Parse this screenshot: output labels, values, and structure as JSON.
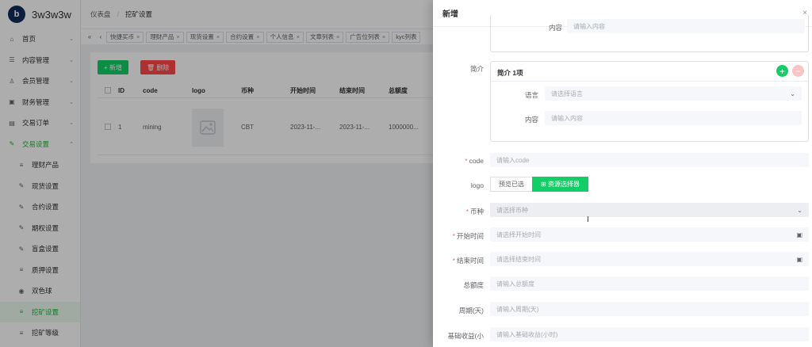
{
  "brand": {
    "name": "3w3w3w",
    "logo_letter": "b"
  },
  "sidebar": {
    "items": [
      {
        "label": "首页",
        "icon": "home-icon",
        "glyph": "⌂"
      },
      {
        "label": "内容管理",
        "icon": "list-icon",
        "glyph": "☰"
      },
      {
        "label": "会员管理",
        "icon": "user-icon",
        "glyph": "♙"
      },
      {
        "label": "财务管理",
        "icon": "finance-icon",
        "glyph": "▣"
      },
      {
        "label": "交易订单",
        "icon": "order-icon",
        "glyph": "▤"
      },
      {
        "label": "交易设置",
        "icon": "tool-icon",
        "glyph": "✎"
      }
    ],
    "sub_items": [
      {
        "label": "理财产品",
        "icon": "menu-lines-icon",
        "glyph": "≡"
      },
      {
        "label": "现货设置",
        "icon": "wrench-icon",
        "glyph": "✎"
      },
      {
        "label": "合约设置",
        "icon": "wrench-icon",
        "glyph": "✎"
      },
      {
        "label": "期权设置",
        "icon": "wrench-icon",
        "glyph": "✎"
      },
      {
        "label": "盲盒设置",
        "icon": "wrench-icon",
        "glyph": "✎"
      },
      {
        "label": "质押设置",
        "icon": "menu-lines-icon",
        "glyph": "≡"
      },
      {
        "label": "双色球",
        "icon": "target-icon",
        "glyph": "◉"
      },
      {
        "label": "挖矿设置",
        "icon": "menu-lines-icon",
        "glyph": "≡"
      },
      {
        "label": "挖矿等级",
        "icon": "menu-lines-icon",
        "glyph": "≡"
      }
    ]
  },
  "breadcrumb": {
    "items": [
      "仪表盘",
      "挖矿设置"
    ]
  },
  "tabs": [
    "快捷买币",
    "理财产品",
    "现货设置",
    "合约设置",
    "个人信息",
    "文章列表",
    "广告位列表",
    "kyc列表"
  ],
  "toolbar": {
    "add_label": "+ 新增",
    "delete_label": "🗑 删除"
  },
  "table": {
    "headers": [
      "ID",
      "code",
      "logo",
      "币种",
      "开始时间",
      "结束时间",
      "总额度"
    ],
    "rows": [
      {
        "id": "1",
        "code": "mining",
        "currency": "CBT",
        "start": "2023-11-...",
        "end": "2023-11-...",
        "total": "1000000..."
      }
    ]
  },
  "drawer": {
    "title": "新增",
    "close": "×",
    "top_content_label": "内容",
    "top_content_placeholder": "请输入内容",
    "intro": {
      "label": "简介",
      "header": "简介 1项",
      "lang_label": "语言",
      "lang_placeholder": "请选择语言",
      "content_label": "内容",
      "content_placeholder": "请输入内容"
    },
    "fields": {
      "code": {
        "label": "code",
        "placeholder": "请输入code"
      },
      "logo": {
        "label": "logo",
        "preview": "预览已选",
        "picker": "⊞ 资源选择器"
      },
      "currency": {
        "label": "币种",
        "placeholder": "请选择币种"
      },
      "start": {
        "label": "开始时间",
        "placeholder": "请选择开始时间"
      },
      "end": {
        "label": "结束时间",
        "placeholder": "请选择结束时间"
      },
      "total": {
        "label": "总额度",
        "placeholder": "请输入总额度"
      },
      "period": {
        "label": "周期(天)",
        "placeholder": "请输入周期(天)"
      },
      "base_income": {
        "label": "基础收益(小",
        "placeholder": "请输入基础收益(小时)"
      }
    }
  },
  "colors": {
    "accent": "#13ce66",
    "danger": "#ff4949",
    "required": "#f56c6c"
  }
}
